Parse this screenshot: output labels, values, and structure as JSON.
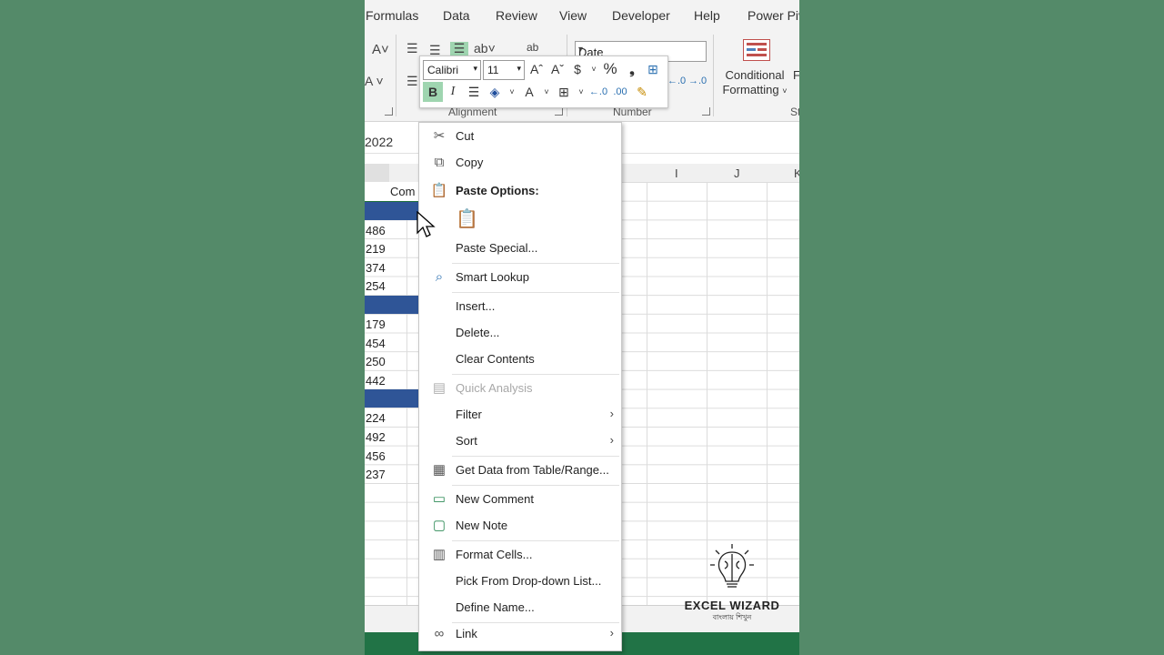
{
  "ribbon": {
    "tabs": [
      "Formulas",
      "Data",
      "Review",
      "View",
      "Developer",
      "Help",
      "Power Piv"
    ],
    "groups": {
      "alignment": "Alignment",
      "number": "Number",
      "styles": "St"
    },
    "number_format": "Date",
    "conditional_formatting": {
      "line1": "Conditional",
      "line2": "Formatting"
    },
    "wrap_label": "ab",
    "extra_label": "F"
  },
  "mini_toolbar": {
    "font": "Calibri",
    "size": "11",
    "currency": "$",
    "percent": "%",
    "comma": "❟"
  },
  "formula_bar": {
    "value": "2022"
  },
  "grid": {
    "columns": [
      "I",
      "J",
      "K"
    ],
    "header_fragment": "Com",
    "values": [
      {
        "row": 0,
        "text": "486"
      },
      {
        "row": 1,
        "text": "219"
      },
      {
        "row": 2,
        "text": "374"
      },
      {
        "row": 3,
        "text": "254"
      },
      {
        "row": 5,
        "text": "179"
      },
      {
        "row": 6,
        "text": "454"
      },
      {
        "row": 7,
        "text": "250"
      },
      {
        "row": 8,
        "text": "442"
      },
      {
        "row": 10,
        "text": "224"
      },
      {
        "row": 11,
        "text": "492"
      },
      {
        "row": 12,
        "text": "456"
      },
      {
        "row": 13,
        "text": "237"
      }
    ]
  },
  "context_menu": {
    "cut": "Cut",
    "copy": "Copy",
    "paste_options": "Paste Options:",
    "paste_special": "Paste Special...",
    "smart_lookup": "Smart Lookup",
    "insert": "Insert...",
    "delete": "Delete...",
    "clear_contents": "Clear Contents",
    "quick_analysis": "Quick Analysis",
    "filter": "Filter",
    "sort": "Sort",
    "get_data": "Get Data from Table/Range...",
    "new_comment": "New Comment",
    "new_note": "New Note",
    "format_cells": "Format Cells...",
    "pick_list": "Pick From Drop-down List...",
    "define_name": "Define Name...",
    "link": "Link"
  },
  "logo": {
    "title": "EXCEL WIZARD",
    "subtitle": "বাংলায় শিখুন"
  }
}
